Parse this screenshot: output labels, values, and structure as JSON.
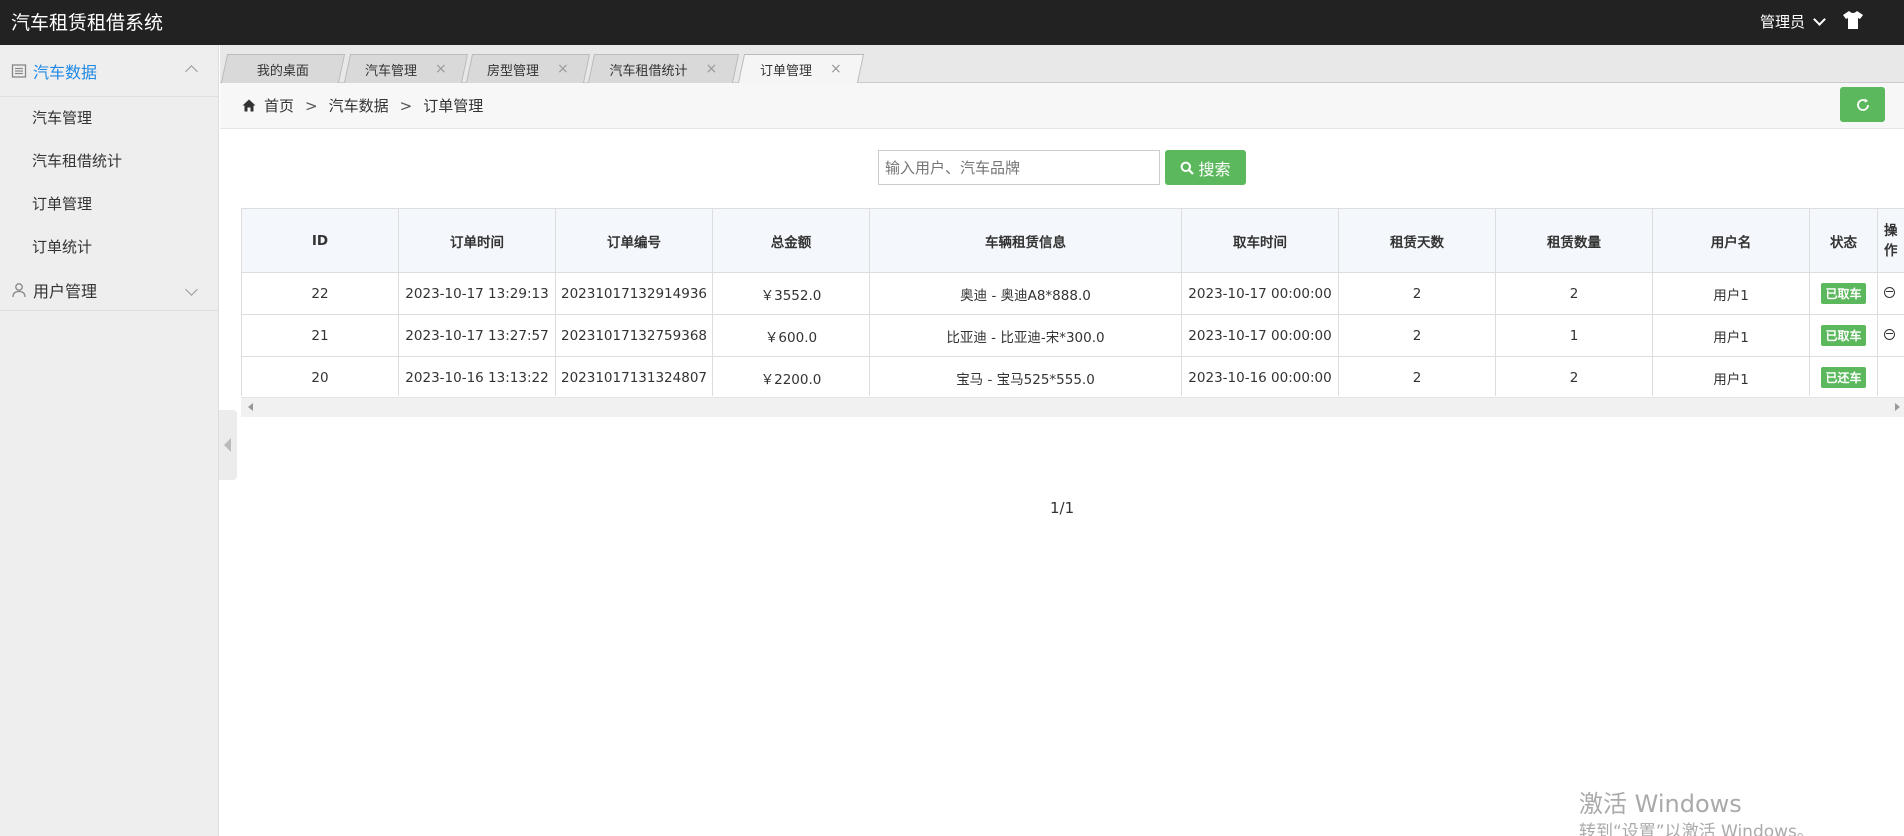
{
  "app": {
    "title": "汽车租赁租借系统",
    "user": "管理员"
  },
  "sidebar": {
    "groups": [
      {
        "label": "汽车数据",
        "items": [
          "汽车管理",
          "汽车租借统计",
          "订单管理",
          "订单统计"
        ]
      },
      {
        "label": "用户管理"
      }
    ]
  },
  "tabs": [
    {
      "label": "我的桌面"
    },
    {
      "label": "汽车管理"
    },
    {
      "label": "房型管理"
    },
    {
      "label": "汽车租借统计"
    },
    {
      "label": "订单管理"
    }
  ],
  "breadcrumb": {
    "home": "首页",
    "sep": ">",
    "level1": "汽车数据",
    "level2": "订单管理"
  },
  "search": {
    "placeholder": "输入用户、汽车品牌",
    "button": "搜索"
  },
  "table": {
    "headers": [
      "ID",
      "订单时间",
      "订单编号",
      "总金额",
      "车辆租赁信息",
      "取车时间",
      "租赁天数",
      "租赁数量",
      "用户名",
      "状态",
      "操作"
    ],
    "rows": [
      {
        "id": "22",
        "time": "2023-10-17 13:29:13",
        "no": "20231017132914936",
        "amount": "￥3552.0",
        "info": "奥迪 - 奥迪A8*888.0",
        "pickup": "2023-10-17 00:00:00",
        "days": "2",
        "qty": "2",
        "user": "用户1",
        "status": "已取车"
      },
      {
        "id": "21",
        "time": "2023-10-17 13:27:57",
        "no": "20231017132759368",
        "amount": "￥600.0",
        "info": "比亚迪 - 比亚迪-宋*300.0",
        "pickup": "2023-10-17 00:00:00",
        "days": "2",
        "qty": "1",
        "user": "用户1",
        "status": "已取车"
      },
      {
        "id": "20",
        "time": "2023-10-16 13:13:22",
        "no": "20231017131324807",
        "amount": "￥2200.0",
        "info": "宝马 - 宝马525*555.0",
        "pickup": "2023-10-16 00:00:00",
        "days": "2",
        "qty": "2",
        "user": "用户1",
        "status": "已还车"
      }
    ]
  },
  "pager": {
    "text": "1/1"
  },
  "watermark": {
    "line1": "激活 Windows",
    "line2": "转到“设置”以激活 Windows。"
  }
}
